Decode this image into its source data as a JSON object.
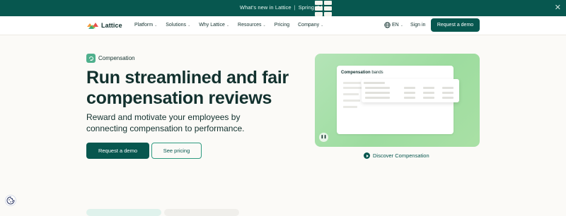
{
  "announcement": {
    "text": "What's new in Lattice",
    "highlight": "Spring '24",
    "arrow": "›",
    "close_icon": "✕"
  },
  "header": {
    "logo_text": "Lattice",
    "nav": [
      {
        "label": "Platform",
        "has_menu": true
      },
      {
        "label": "Solutions",
        "has_menu": true
      },
      {
        "label": "Why Lattice",
        "has_menu": true
      },
      {
        "label": "Resources",
        "has_menu": true
      },
      {
        "label": "Pricing",
        "has_menu": false
      },
      {
        "label": "Company",
        "has_menu": true
      }
    ],
    "chevron": "⌄",
    "language": "EN",
    "signin": "Sign in",
    "cta": "Request a demo"
  },
  "hero": {
    "chip": "Compensation",
    "title": "Run streamlined and fair compensation reviews",
    "subtitle": "Reward and motivate your employees by connecting compensation to performance.",
    "primary_cta": "Request a demo",
    "secondary_cta": "See pricing"
  },
  "media": {
    "card_title_bold": "Compensation",
    "card_title_rest": " bands",
    "pause_icon": "❚❚",
    "discover_label": "Discover Compensation"
  },
  "colors": {
    "brand": "#07574f",
    "accent": "#2f9b80",
    "media_bg": "#a9e0a5"
  },
  "icons": [
    "close-icon",
    "globe-icon",
    "chevron-down-icon",
    "compensation-icon",
    "pause-icon",
    "play-icon",
    "cookie-icon"
  ]
}
